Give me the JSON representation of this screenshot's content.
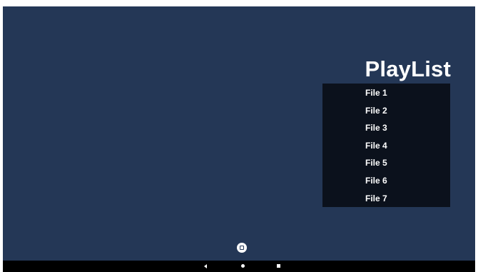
{
  "playlist": {
    "title": "PlayList",
    "items": [
      "File 1",
      "File 2",
      "File 3",
      "File 4",
      "File 5",
      "File 6",
      "File 7"
    ]
  },
  "icons": {
    "floating_button": "square-in-circle-icon",
    "nav_back": "back-triangle-icon",
    "nav_home": "home-dot-icon",
    "nav_recent": "recent-apps-square-icon"
  },
  "colors": {
    "background": "#243756",
    "playlist_bg": "#0b111c",
    "text": "#ffffff",
    "navbar": "#000000"
  }
}
